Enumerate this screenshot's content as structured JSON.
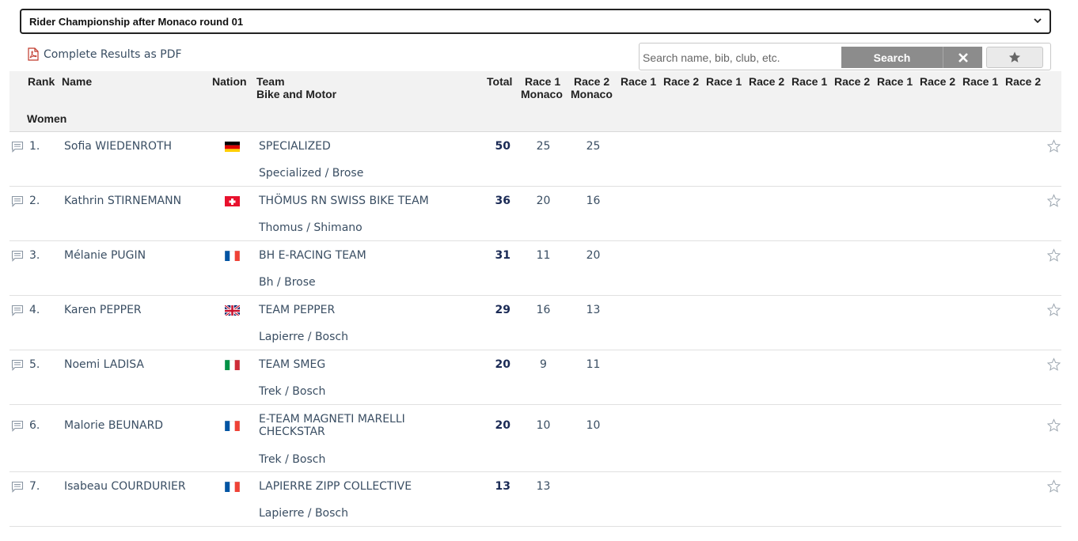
{
  "header": {
    "championship_select": "Rider Championship after Monaco round 01",
    "pdf_link": "Complete Results as PDF"
  },
  "search": {
    "placeholder": "Search name, bib, club, etc.",
    "button_label": "Search"
  },
  "table": {
    "columns": {
      "rank": "Rank",
      "name": "Name",
      "nation": "Nation",
      "team": "Team",
      "bike": "Bike and Motor",
      "total": "Total",
      "race1_monaco": "Race 1",
      "race1_monaco_sub": "Monaco",
      "race2_monaco": "Race 2",
      "race2_monaco_sub": "Monaco",
      "extra_races": [
        "Race 1",
        "Race 2",
        "Race 1",
        "Race 2",
        "Race 1",
        "Race 2",
        "Race 1",
        "Race 2",
        "Race 1",
        "Race 2"
      ]
    },
    "group": "Women",
    "rows": [
      {
        "rank": "1.",
        "name": "Sofia WIEDENROTH",
        "nation": "GER",
        "team": "SPECIALIZED",
        "team_line2": "",
        "bike": "Specialized / Brose",
        "total": "50",
        "race1": "25",
        "race2": "25"
      },
      {
        "rank": "2.",
        "name": "Kathrin STIRNEMANN",
        "nation": "SUI",
        "team": "THÖMUS RN SWISS BIKE TEAM",
        "team_line2": "",
        "bike": "Thomus / Shimano",
        "total": "36",
        "race1": "20",
        "race2": "16"
      },
      {
        "rank": "3.",
        "name": "Mélanie PUGIN",
        "nation": "FRA",
        "team": "BH E-RACING TEAM",
        "team_line2": "",
        "bike": "Bh / Brose",
        "total": "31",
        "race1": "11",
        "race2": "20"
      },
      {
        "rank": "4.",
        "name": "Karen PEPPER",
        "nation": "GBR",
        "team": "TEAM PEPPER",
        "team_line2": "",
        "bike": "Lapierre / Bosch",
        "total": "29",
        "race1": "16",
        "race2": "13"
      },
      {
        "rank": "5.",
        "name": "Noemi LADISA",
        "nation": "ITA",
        "team": "TEAM SMEG",
        "team_line2": "",
        "bike": "Trek / Bosch",
        "total": "20",
        "race1": "9",
        "race2": "11"
      },
      {
        "rank": "6.",
        "name": "Malorie BEUNARD",
        "nation": "FRA",
        "team": "E-TEAM MAGNETI MARELLI",
        "team_line2": "CHECKSTAR",
        "bike": "Trek / Bosch",
        "total": "20",
        "race1": "10",
        "race2": "10"
      },
      {
        "rank": "7.",
        "name": "Isabeau COURDURIER",
        "nation": "FRA",
        "team": "LAPIERRE ZIPP COLLECTIVE",
        "team_line2": "",
        "bike": "Lapierre / Bosch",
        "total": "13",
        "race1": "13",
        "race2": ""
      }
    ]
  },
  "icons": {
    "comment": "comment-icon",
    "favorite": "star-outline-icon",
    "pdf": "pdf-file-icon",
    "clear": "close-icon",
    "favorites_filter": "star-icon"
  },
  "colors": {
    "header_bg": "#f2f2f2",
    "button_gray": "#8c8c8c",
    "text": "#3a4e63",
    "total_text": "#1a2a55"
  }
}
